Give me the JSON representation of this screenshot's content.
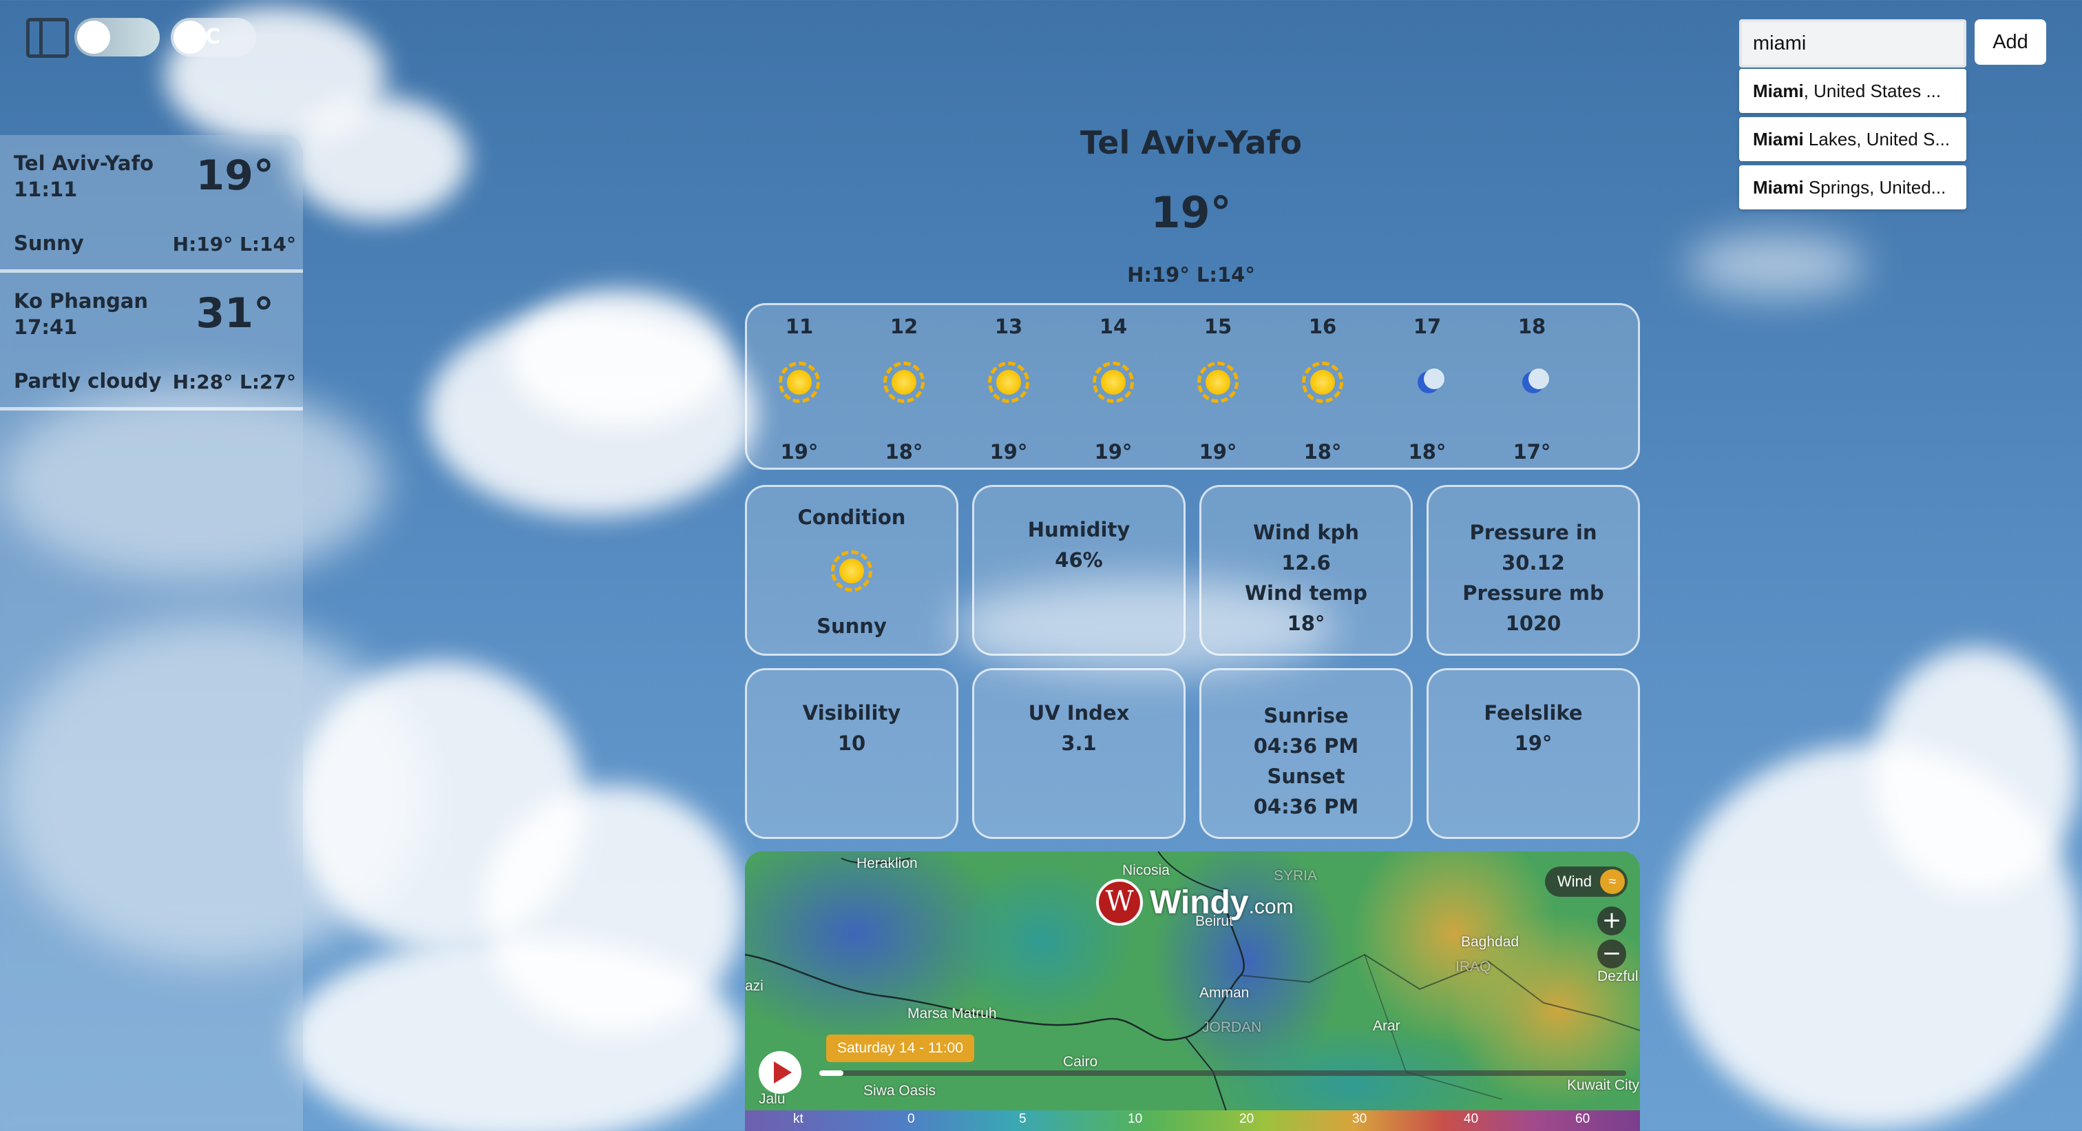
{
  "controls": {
    "sidebar_toggle_icon": "sidebar-panel-icon",
    "theme_toggle_icon": "cloud-toggle-icon",
    "unit_toggle_label": "C"
  },
  "sidebar": {
    "cities": [
      {
        "name": "Tel Aviv-Yafo",
        "time": "11:11",
        "temp": "19°",
        "condition": "Sunny",
        "high_low": "H:19° L:14°"
      },
      {
        "name": "Ko Phangan",
        "time": "17:41",
        "temp": "31°",
        "condition": "Partly cloudy",
        "high_low": "H:28° L:27°"
      }
    ]
  },
  "current": {
    "city": "Tel Aviv-Yafo",
    "temp": "19°",
    "high_low": "H:19° L:14°"
  },
  "hourly": [
    {
      "hour": "11",
      "icon": "sun-icon",
      "temp": "19°"
    },
    {
      "hour": "12",
      "icon": "sun-icon",
      "temp": "18°"
    },
    {
      "hour": "13",
      "icon": "sun-icon",
      "temp": "19°"
    },
    {
      "hour": "14",
      "icon": "sun-icon",
      "temp": "19°"
    },
    {
      "hour": "15",
      "icon": "sun-icon",
      "temp": "19°"
    },
    {
      "hour": "16",
      "icon": "sun-icon",
      "temp": "18°"
    },
    {
      "hour": "17",
      "icon": "moon-icon",
      "temp": "18°"
    },
    {
      "hour": "18",
      "icon": "moon-icon",
      "temp": "17°"
    }
  ],
  "tiles": {
    "condition": {
      "label": "Condition",
      "value": "Sunny",
      "icon": "sun-icon"
    },
    "humidity": {
      "label": "Humidity",
      "value": "46%"
    },
    "wind": {
      "label": "Wind kph",
      "value": "12.6",
      "temp_label": "Wind temp",
      "temp_value": "18°"
    },
    "pressure": {
      "label": "Pressure in",
      "value": "30.12",
      "mb_label": "Pressure mb",
      "mb_value": "1020"
    },
    "visibility": {
      "label": "Visibility",
      "value": "10"
    },
    "uv": {
      "label": "UV Index",
      "value": "3.1"
    },
    "sun": {
      "sunrise_label": "Sunrise",
      "sunrise": "04:36 PM",
      "sunset_label": "Sunset",
      "sunset": "04:36 PM"
    },
    "feelslike": {
      "label": "Feelslike",
      "value": "19°"
    }
  },
  "map": {
    "brand": "Windy",
    "brand_suffix": ".com",
    "layer_label": "Wind",
    "time_label": "Saturday 14 - 11:00",
    "timeline_progress": 0.03,
    "places": [
      "Heraklion",
      "Nicosia",
      "SYRIA",
      "Beirut",
      "Baghdad",
      "IRAQ",
      "Dezful",
      "azi",
      "Amman",
      "JORDAN",
      "Arar",
      "Marsa Matruh",
      "Cairo",
      "Siwa Oasis",
      "Jalu",
      "Kuwait City"
    ],
    "scale_unit": "kt",
    "scale_ticks": [
      "0",
      "5",
      "10",
      "20",
      "30",
      "40",
      "60"
    ]
  },
  "search": {
    "query": "miami",
    "add_label": "Add",
    "suggestions": [
      {
        "match": "Miami",
        "rest": ", United States ..."
      },
      {
        "match": "Miami",
        "rest": " Lakes, United S..."
      },
      {
        "match": "Miami",
        "rest": " Springs, United..."
      }
    ]
  },
  "colors": {
    "sky": "#4c82b8",
    "text": "#1e2a38",
    "sun": "#f8c200",
    "moon": "#2d5fd0",
    "windy_red": "#b71c1c",
    "time_chip": "#e3a324"
  }
}
